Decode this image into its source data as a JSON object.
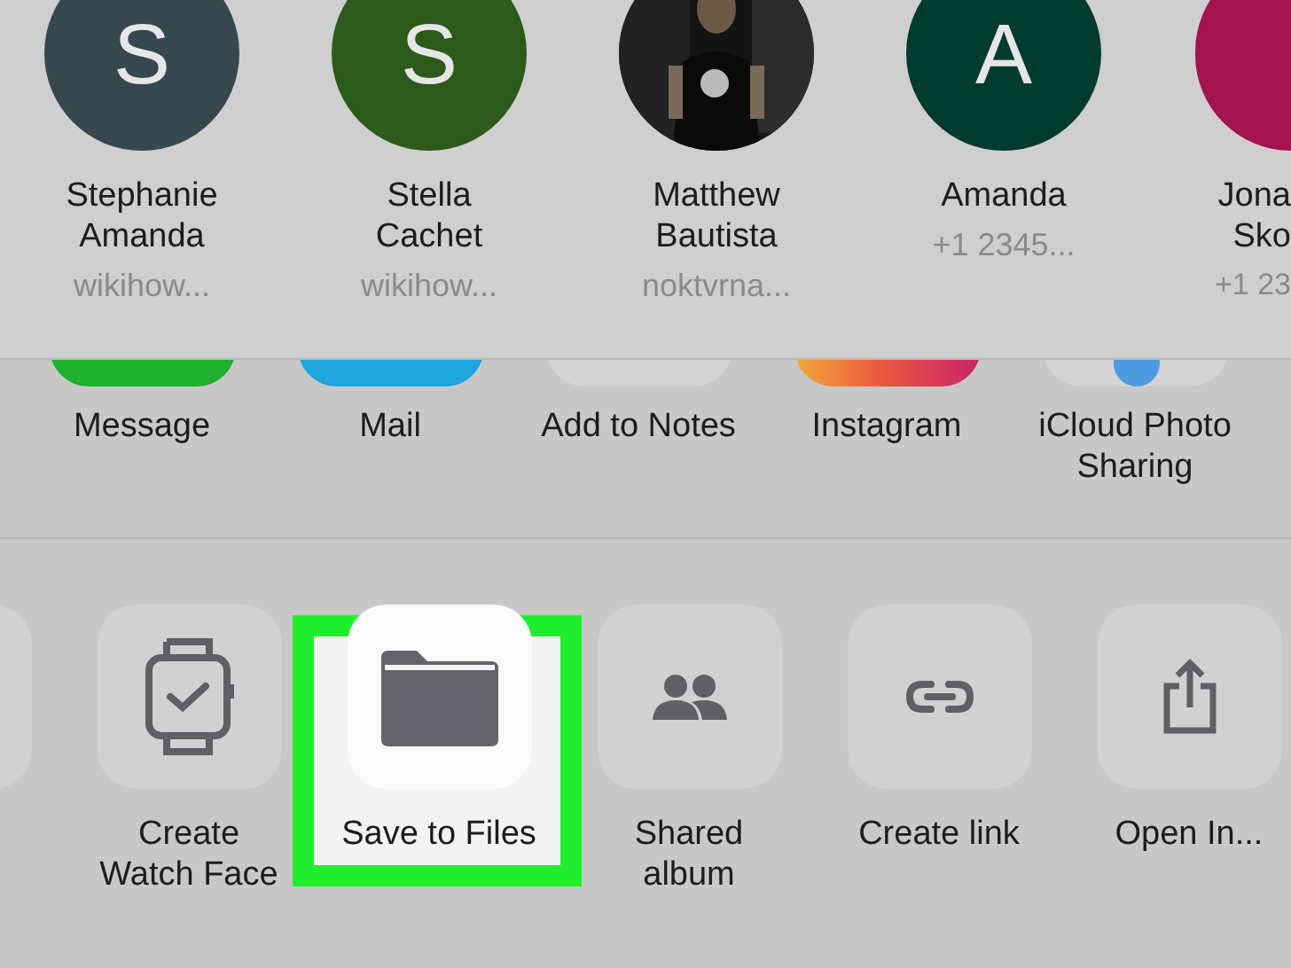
{
  "contacts": [
    {
      "kind": "initial",
      "initial": "S",
      "color": "#37474f",
      "name": "Stephanie Amanda",
      "detail": "wikihow..."
    },
    {
      "kind": "initial",
      "initial": "S",
      "color": "#2b5a1a",
      "name": "Stella Cachet",
      "detail": "wikihow..."
    },
    {
      "name": "Matthew Bautista",
      "detail": "noktvrna..."
    },
    {
      "kind": "initial",
      "initial": "A",
      "color": "#003c2e",
      "name": "Amanda",
      "detail": "+1 2345..."
    },
    {
      "kind": "initial",
      "color": "#a4134f",
      "name": "Jona Sko",
      "detail": "+1 23"
    }
  ],
  "apps": [
    {
      "kind": "message",
      "label": "Message"
    },
    {
      "kind": "mail",
      "label": "Mail"
    },
    {
      "kind": "notes",
      "label": "Add to Notes"
    },
    {
      "kind": "instagram",
      "label": "Instagram"
    },
    {
      "kind": "icloud",
      "label": "iCloud Photo Sharing"
    }
  ],
  "actions": [
    {
      "kind": "watch",
      "label": "Create Watch Face",
      "highlighted": false
    },
    {
      "kind": "folder",
      "label": "Save to Files",
      "highlighted": true
    },
    {
      "kind": "people",
      "label": "Shared album",
      "highlighted": false
    },
    {
      "kind": "link",
      "label": "Create link",
      "highlighted": false
    },
    {
      "kind": "share",
      "label": "Open In...",
      "highlighted": false
    }
  ]
}
